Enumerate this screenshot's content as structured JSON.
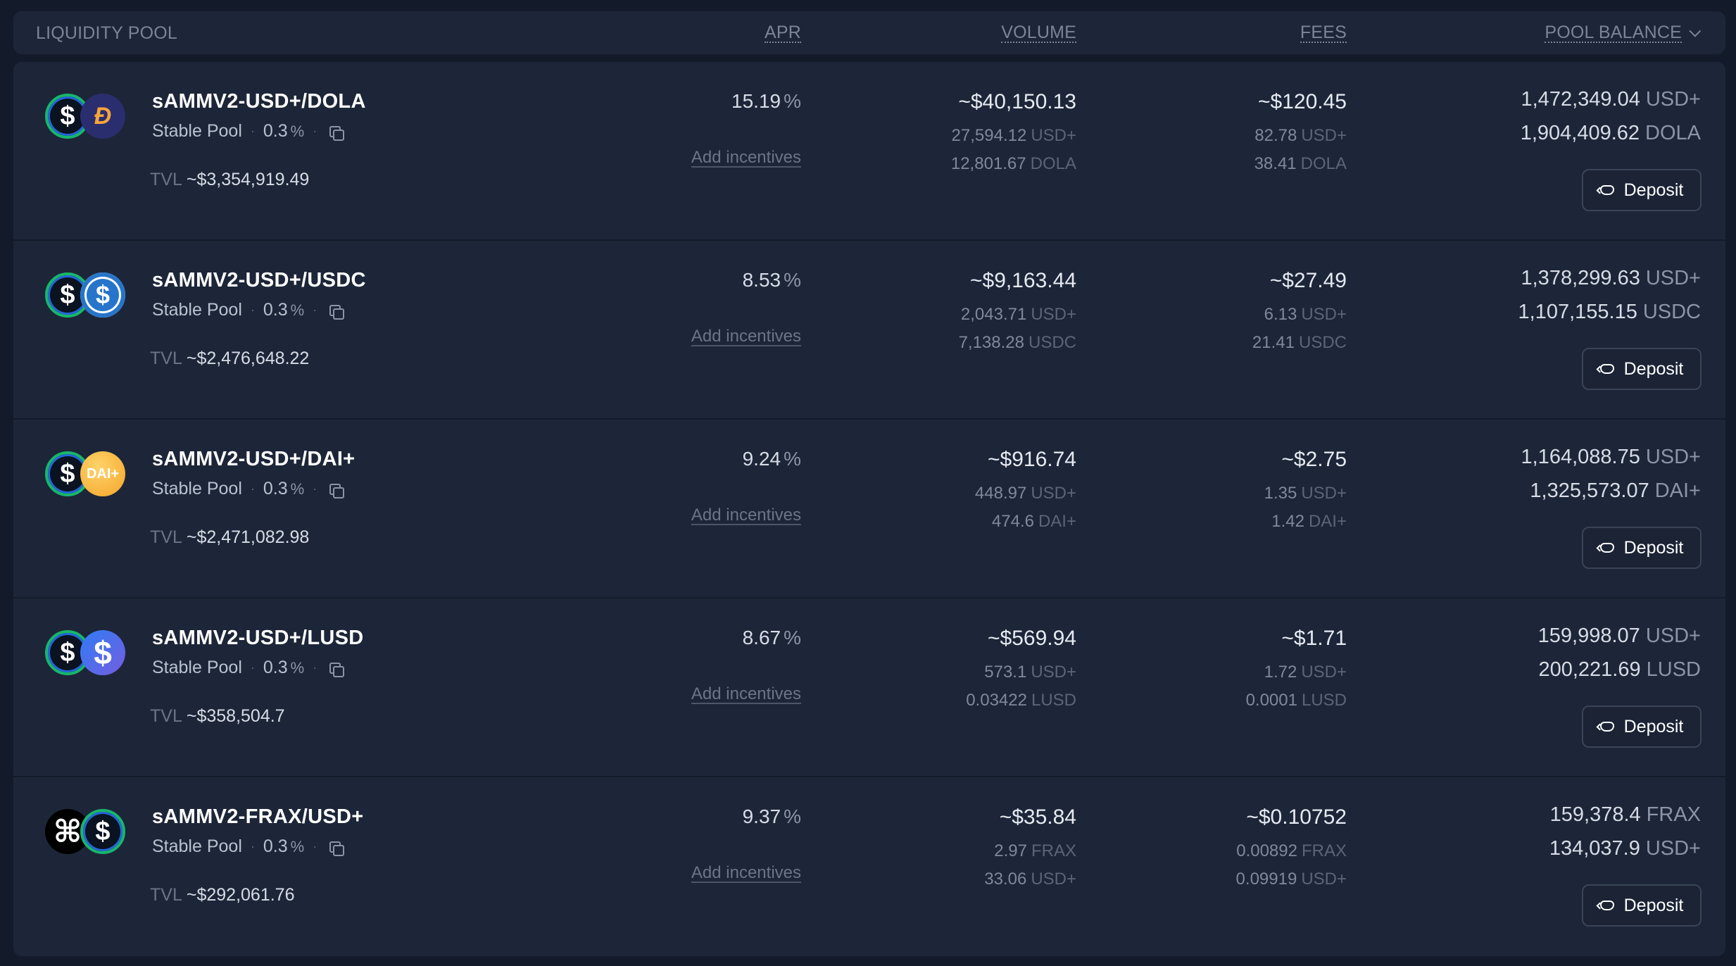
{
  "header": {
    "pool": "LIQUIDITY POOL",
    "apr": "APR",
    "volume": "VOLUME",
    "fees": "FEES",
    "balance": "POOL BALANCE"
  },
  "common": {
    "pool_type": "Stable Pool",
    "fee": "0.3",
    "pct": "%",
    "tvl_label": "TVL",
    "add_incentives": "Add incentives",
    "deposit": "Deposit"
  },
  "pools": [
    {
      "name": "sAMMV2-USD+/DOLA",
      "icons": [
        "usdplus-icon",
        "dola-icon"
      ],
      "tvl": "~$3,354,919.49",
      "apr": "15.19",
      "volume": "~$40,150.13",
      "volume_sub": [
        {
          "amount": "27,594.12",
          "token": "USD+"
        },
        {
          "amount": "12,801.67",
          "token": "DOLA"
        }
      ],
      "fees": "~$120.45",
      "fees_sub": [
        {
          "amount": "82.78",
          "token": "USD+"
        },
        {
          "amount": "38.41",
          "token": "DOLA"
        }
      ],
      "balance": [
        {
          "amount": "1,472,349.04",
          "token": "USD+"
        },
        {
          "amount": "1,904,409.62",
          "token": "DOLA"
        }
      ]
    },
    {
      "name": "sAMMV2-USD+/USDC",
      "icons": [
        "usdplus-icon",
        "usdc-icon"
      ],
      "tvl": "~$2,476,648.22",
      "apr": "8.53",
      "volume": "~$9,163.44",
      "volume_sub": [
        {
          "amount": "2,043.71",
          "token": "USD+"
        },
        {
          "amount": "7,138.28",
          "token": "USDC"
        }
      ],
      "fees": "~$27.49",
      "fees_sub": [
        {
          "amount": "6.13",
          "token": "USD+"
        },
        {
          "amount": "21.41",
          "token": "USDC"
        }
      ],
      "balance": [
        {
          "amount": "1,378,299.63",
          "token": "USD+"
        },
        {
          "amount": "1,107,155.15",
          "token": "USDC"
        }
      ]
    },
    {
      "name": "sAMMV2-USD+/DAI+",
      "icons": [
        "usdplus-icon",
        "daiplus-icon"
      ],
      "tvl": "~$2,471,082.98",
      "apr": "9.24",
      "volume": "~$916.74",
      "volume_sub": [
        {
          "amount": "448.97",
          "token": "USD+"
        },
        {
          "amount": "474.6",
          "token": "DAI+"
        }
      ],
      "fees": "~$2.75",
      "fees_sub": [
        {
          "amount": "1.35",
          "token": "USD+"
        },
        {
          "amount": "1.42",
          "token": "DAI+"
        }
      ],
      "balance": [
        {
          "amount": "1,164,088.75",
          "token": "USD+"
        },
        {
          "amount": "1,325,573.07",
          "token": "DAI+"
        }
      ]
    },
    {
      "name": "sAMMV2-USD+/LUSD",
      "icons": [
        "usdplus-icon",
        "lusd-icon"
      ],
      "tvl": "~$358,504.7",
      "apr": "8.67",
      "volume": "~$569.94",
      "volume_sub": [
        {
          "amount": "573.1",
          "token": "USD+"
        },
        {
          "amount": "0.03422",
          "token": "LUSD"
        }
      ],
      "fees": "~$1.71",
      "fees_sub": [
        {
          "amount": "1.72",
          "token": "USD+"
        },
        {
          "amount": "0.0001",
          "token": "LUSD"
        }
      ],
      "balance": [
        {
          "amount": "159,998.07",
          "token": "USD+"
        },
        {
          "amount": "200,221.69",
          "token": "LUSD"
        }
      ]
    },
    {
      "name": "sAMMV2-FRAX/USD+",
      "icons": [
        "frax-icon",
        "usdplus-icon"
      ],
      "tvl": "~$292,061.76",
      "apr": "9.37",
      "volume": "~$35.84",
      "volume_sub": [
        {
          "amount": "2.97",
          "token": "FRAX"
        },
        {
          "amount": "33.06",
          "token": "USD+"
        }
      ],
      "fees": "~$0.10752",
      "fees_sub": [
        {
          "amount": "0.00892",
          "token": "FRAX"
        },
        {
          "amount": "0.09919",
          "token": "USD+"
        }
      ],
      "balance": [
        {
          "amount": "159,378.4",
          "token": "FRAX"
        },
        {
          "amount": "134,037.9",
          "token": "USD+"
        }
      ]
    }
  ]
}
